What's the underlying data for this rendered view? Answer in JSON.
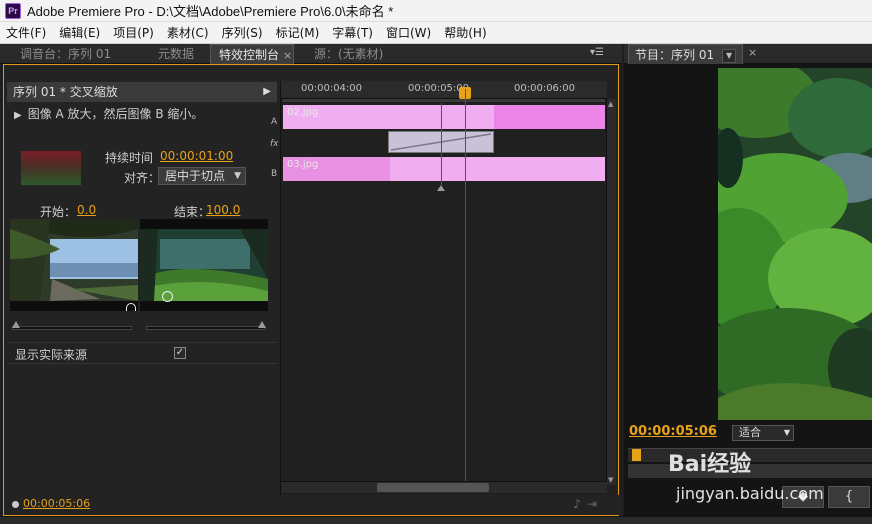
{
  "window": {
    "title": "Adobe Premiere Pro - D:\\文档\\Adobe\\Premiere Pro\\6.0\\未命名 *",
    "logo_text": "Pr"
  },
  "menu": [
    "文件(F)",
    "编辑(E)",
    "项目(P)",
    "素材(C)",
    "序列(S)",
    "标记(M)",
    "字幕(T)",
    "窗口(W)",
    "帮助(H)"
  ],
  "tabs": {
    "mixer": "调音台：序列 01",
    "metadata": "元数据",
    "effect_controls": "特效控制台",
    "source": "源：(无素材)",
    "close_glyph": "×",
    "menu_glyph": "▾☰"
  },
  "effect_controls": {
    "sequence_header": "序列 01 * 交叉缩放",
    "description": "图像 A 放大，然后图像 B 缩小。",
    "duration_label": "持续时间",
    "duration_value": "00:00:01:00",
    "align_label": "对齐：",
    "align_value": "居中于切点",
    "start_label": "开始：",
    "start_value": "0.0",
    "end_label": "结束：",
    "end_value": "100.0",
    "show_source_label": "显示实际来源",
    "show_source_checked": "✓",
    "current_time": "00:00:05:06"
  },
  "timeline": {
    "ticks": [
      "00:00:04:00",
      "00:00:05:00",
      "00:00:06:00"
    ],
    "track_a_letter": "A",
    "track_b_letter": "B",
    "fx_letter": "fx",
    "clip_a": "02.jpg",
    "clip_b": "03.jpg"
  },
  "program": {
    "tab": "节目：序列 01",
    "timecode": "00:00:05:06",
    "fit": "适合",
    "buttons": [
      "◆",
      "{"
    ]
  },
  "watermark": {
    "brand": "Bai经验",
    "url": "jingyan.baidu.com"
  },
  "colors": {
    "accent_timecode": "#e8a219",
    "playhead": "#e01919",
    "clip_pink": "#f0aef0",
    "clip_pink_dark": "#ec84e6",
    "panel_focus_border": "#e29a14"
  }
}
